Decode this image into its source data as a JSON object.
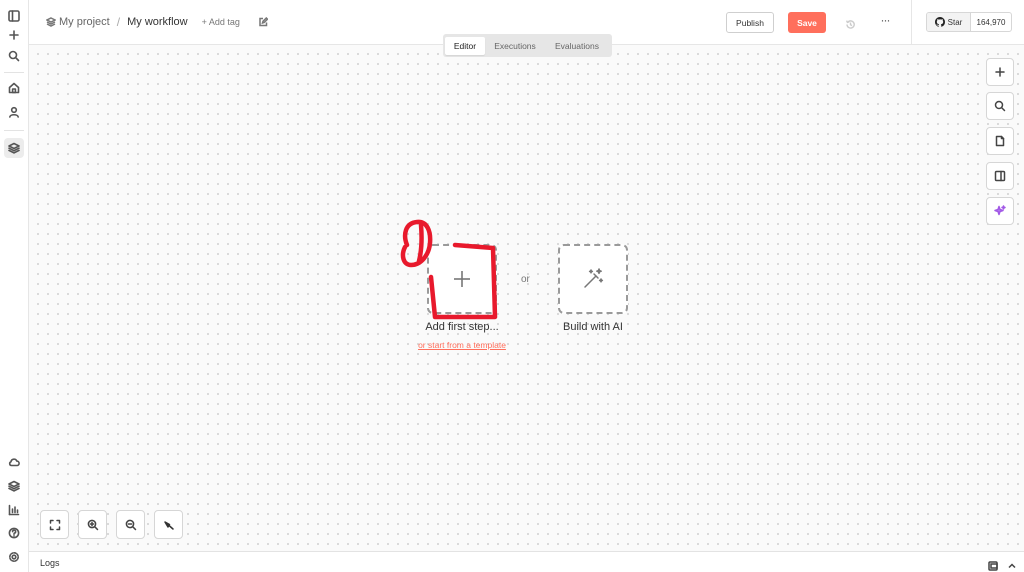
{
  "header": {
    "project": "My project",
    "separator": "/",
    "workflow": "My workflow",
    "add_tag": "+ Add tag",
    "publish": "Publish",
    "save": "Save",
    "more": "···"
  },
  "github": {
    "star": "Star",
    "count": "164,970"
  },
  "tabs": [
    {
      "label": "Editor",
      "active": true
    },
    {
      "label": "Executions"
    },
    {
      "label": "Evaluations"
    }
  ],
  "canvas": {
    "add_first_step": "Add first step...",
    "or": "or",
    "template_link": "or start from a template",
    "build_with_ai": "Build with AI"
  },
  "logs": {
    "label": "Logs"
  },
  "colors": {
    "accent": "#ff6f5c",
    "annotation": "#e8192c"
  }
}
